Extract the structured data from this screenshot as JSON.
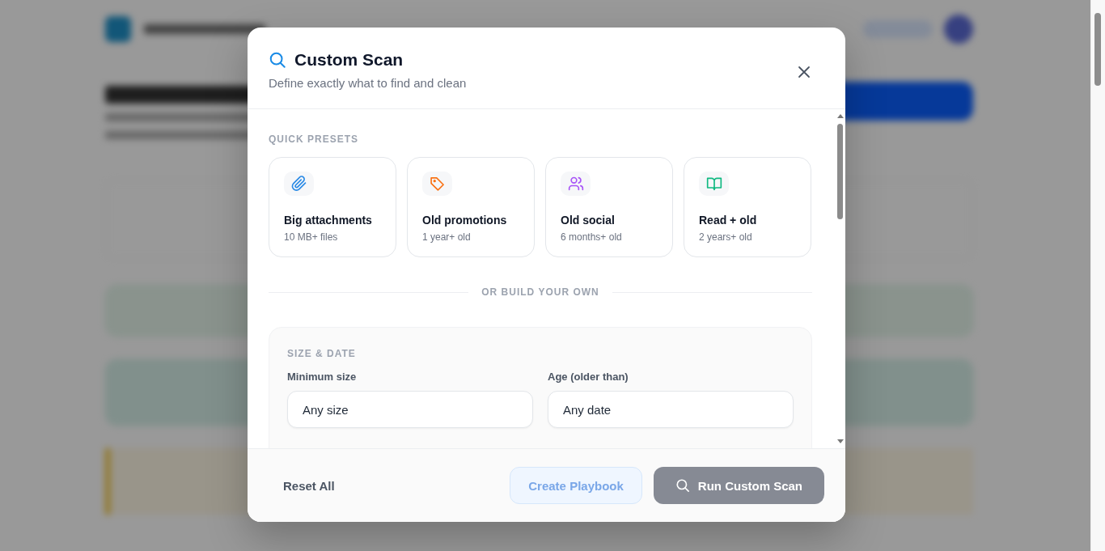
{
  "dialog": {
    "title": "Custom Scan",
    "subtitle": "Define exactly what to find and clean"
  },
  "presets_heading": "QUICK PRESETS",
  "presets": [
    {
      "title": "Big attachments",
      "detail": "10 MB+ files",
      "kind": "paperclip",
      "color": "#2b8be6"
    },
    {
      "title": "Old promotions",
      "detail": "1 year+ old",
      "kind": "tag",
      "color": "#f97316"
    },
    {
      "title": "Old social",
      "detail": "6 months+ old",
      "kind": "people",
      "color": "#a855f7"
    },
    {
      "title": "Read + old",
      "detail": "2 years+ old",
      "kind": "book",
      "color": "#10b981"
    }
  ],
  "divider": "OR BUILD YOUR OWN",
  "section": {
    "heading": "SIZE & DATE",
    "fields": [
      {
        "label": "Minimum size",
        "value": "Any size"
      },
      {
        "label": "Age (older than)",
        "value": "Any date"
      }
    ]
  },
  "footer": {
    "reset": {
      "label": "Reset All",
      "disabled": false
    },
    "playbook": {
      "label": "Create Playbook",
      "disabled": true
    },
    "run": {
      "label": "Run Custom Scan",
      "disabled": true
    }
  }
}
